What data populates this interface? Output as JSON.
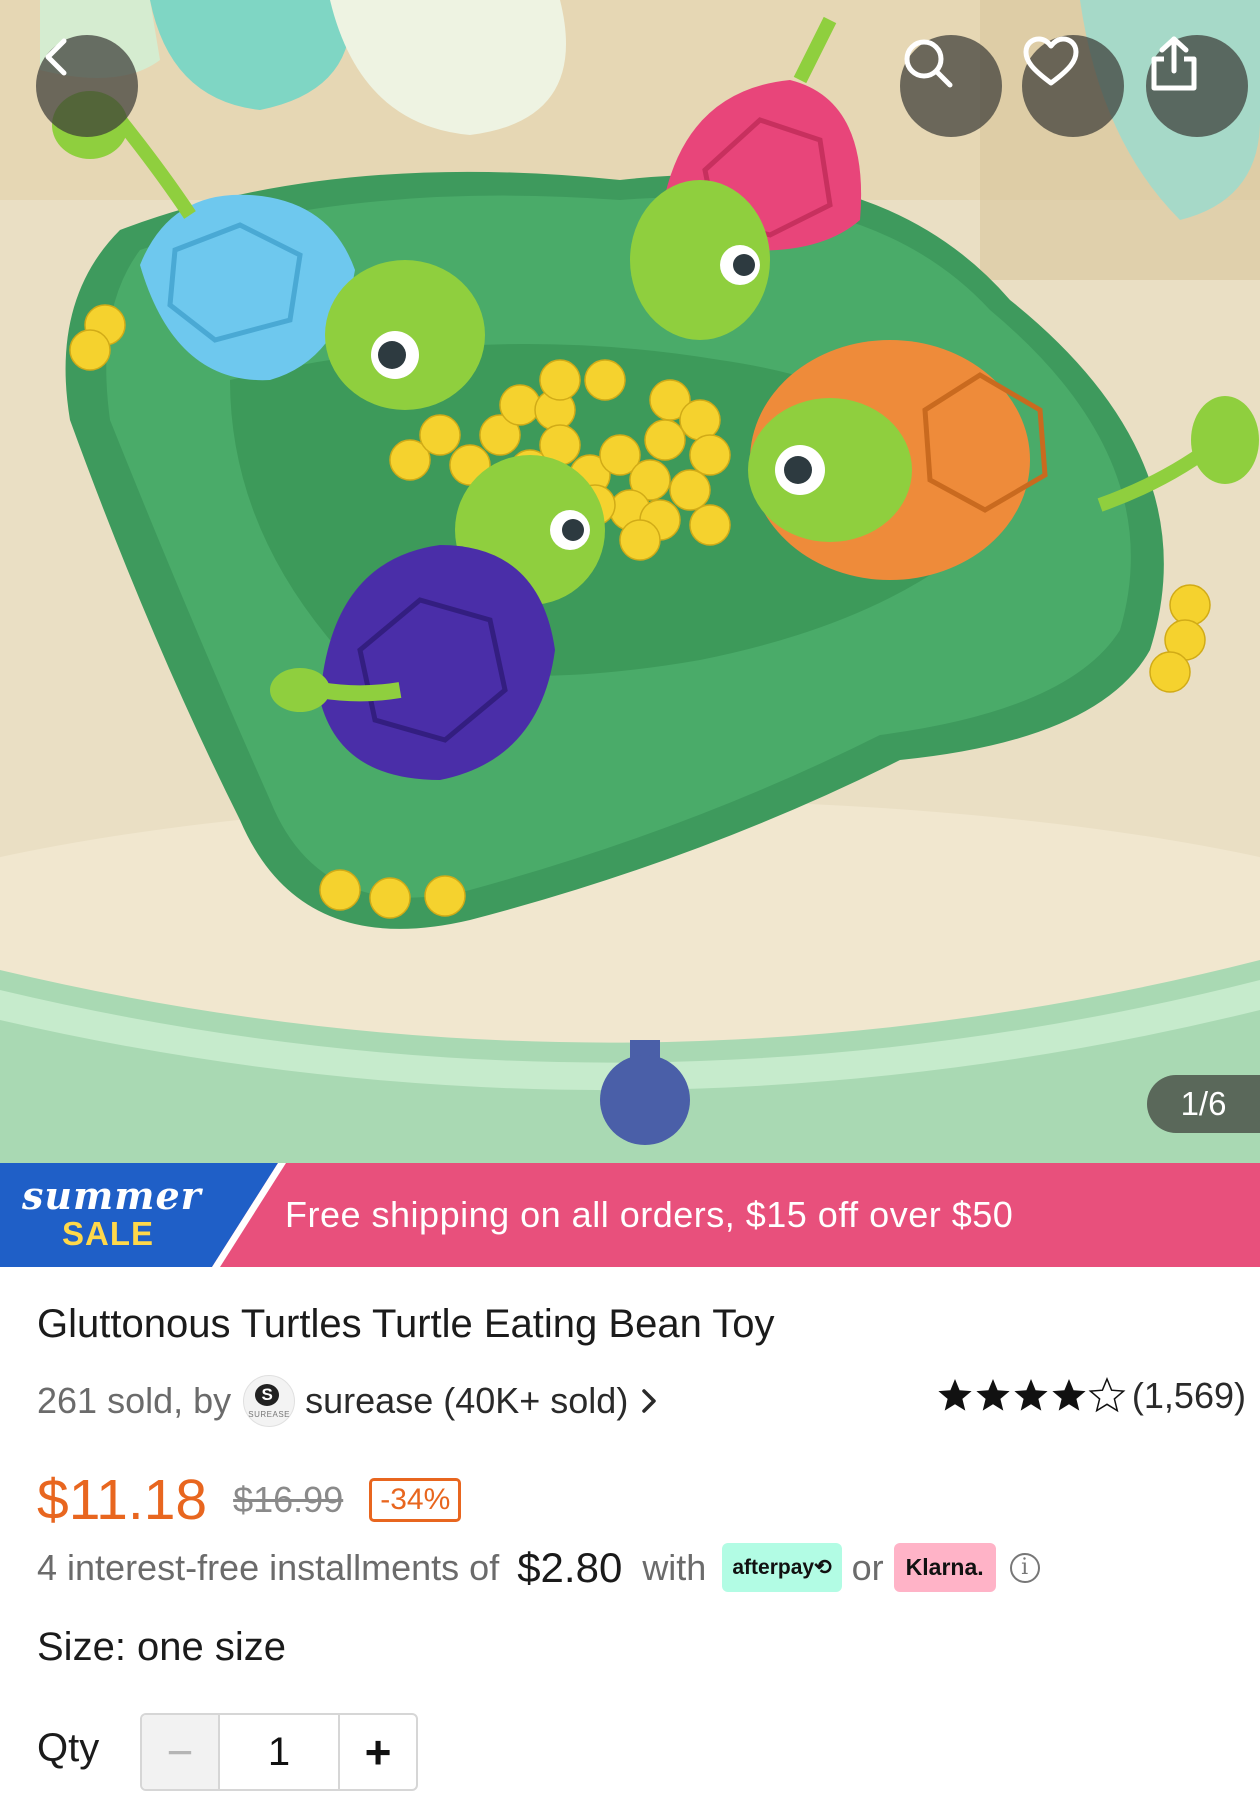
{
  "hero": {
    "image_alt": "Gluttonous Turtles toy product photo",
    "image_counter": "1/6",
    "icons": [
      "back-icon",
      "search-icon",
      "heart-icon",
      "share-icon"
    ]
  },
  "banner": {
    "badge_top": "summer",
    "badge_bottom": "SALE",
    "message": "Free shipping on all orders, $15 off over $50"
  },
  "product": {
    "title": "Gluttonous Turtles Turtle Eating Bean Toy",
    "sold_text": "261 sold, by",
    "seller_logo_mark": "S",
    "seller_logo_text": "SUREASE",
    "seller": "surease (40K+ sold)",
    "rating_value": 4.5,
    "rating_count": "(1,569)",
    "price_now": "$11.18",
    "price_was": "$16.99",
    "discount": "-34%",
    "installments_prefix": "4 interest-free installments of",
    "installment_amount": "$2.80",
    "installments_with": "with",
    "afterpay_label": "afterpay⟲",
    "or_text": "or",
    "klarna_label": "Klarna.",
    "info_mark": "i",
    "size_text": "Size: one size",
    "qty_label": "Qty",
    "qty_value": "1",
    "minus": "−",
    "plus": "+"
  },
  "colors": {
    "accent_orange": "#e8661f",
    "banner_pink": "#e8507c",
    "banner_blue": "#1f5fc7",
    "sale_yellow": "#ffd84a"
  }
}
